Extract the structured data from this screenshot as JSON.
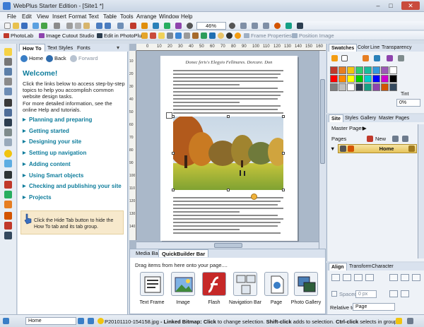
{
  "window": {
    "title": "WebPlus Starter Edition - [Site1 *]",
    "minimize": "–",
    "maximize": "□",
    "close": "✕"
  },
  "menu": [
    "File",
    "Edit",
    "View",
    "Insert",
    "Format",
    "Text",
    "Table",
    "Tools",
    "Arrange",
    "Window",
    "Help"
  ],
  "toolbar": {
    "zoom": "46%",
    "photolab": "PhotoLab",
    "image_cutout": "Image Cutout Studio",
    "edit_photoplus": "Edit in PhotoPlus",
    "frame_properties": "Frame Properties",
    "position_image": "Position Image"
  },
  "howto_panel": {
    "tabs": [
      "How To",
      "Text Styles",
      "Fonts"
    ],
    "home": "Home",
    "back": "Back",
    "forward": "Forward",
    "title": "Welcome!",
    "intro1": "Click the links below to access step-by-step topics to help you accomplish common website design tasks.",
    "intro2": "For more detailed information, see the online Help and tutorials.",
    "topics": [
      "Planning and preparing",
      "Getting started",
      "Designing your site",
      "Setting up navigation",
      "Adding content",
      "Using Smart objects",
      "Checking and publishing your site",
      "Projects"
    ],
    "tip": "Click the    Hide Tab button to hide the How To tab and its tab group."
  },
  "document": {
    "header": "Donec feris's Elegyio Fellinares. Dorcare. Don",
    "ruler_h": [
      "0",
      "10",
      "20",
      "30",
      "40",
      "50",
      "60",
      "70",
      "80",
      "90",
      "100",
      "110",
      "120",
      "130",
      "140",
      "150",
      "160"
    ],
    "ruler_v": [
      "10",
      "20",
      "30",
      "40",
      "50",
      "60",
      "70",
      "80",
      "90",
      "100",
      "110",
      "120",
      "130",
      "140"
    ]
  },
  "quickbuilder": {
    "tabs": [
      "Media Bar",
      "QuickBuilder Bar"
    ],
    "hint": "Drag items from here onto your page....",
    "items": [
      "Text Frame",
      "Image",
      "Flash",
      "Navigation Bar",
      "Page",
      "Photo Gallery"
    ]
  },
  "swatches_panel": {
    "tabs": [
      "Swatches",
      "Color",
      "Line",
      "Transparency"
    ],
    "tint_label": "Tint",
    "tint_value": "0%",
    "colors": [
      "#c0392b",
      "#e67e22",
      "#f1c40f",
      "#2ecc71",
      "#1abc9c",
      "#3498db",
      "#9b59b6",
      "#ffffff",
      "#ff0000",
      "#ff8800",
      "#ffff00",
      "#00cc00",
      "#00cccc",
      "#0000ff",
      "#cc00cc",
      "#000000",
      "#7f7f7f",
      "#bfbfbf",
      "#ffffff",
      "#2c3e50",
      "#16a085",
      "#8e44ad",
      "#d35400",
      "#34495e"
    ]
  },
  "site_panel": {
    "tabs": [
      "Site",
      "Styles",
      "Gallery",
      "Master Pages"
    ],
    "master_pages": "Master Pages",
    "pages": "Pages",
    "new_button": "New",
    "home_page": "Home"
  },
  "align_panel": {
    "tabs": [
      "Align",
      "Transform",
      "Character"
    ],
    "spaced": "Spaced",
    "spaced_value": "0 px",
    "relative_to": "Relative to:",
    "relative_value": "Page"
  },
  "status": {
    "page": "Home",
    "filename": "P20101110-154158.jpg",
    "message_bold": "- Linked Bitmap:",
    "message_click": "Click",
    "message_rest": "to change selection.",
    "message_shift": "Shift-click",
    "message_rest2": "adds to selection.",
    "message_ctrl": "Ctrl-click",
    "message_rest3": "selects in group."
  }
}
